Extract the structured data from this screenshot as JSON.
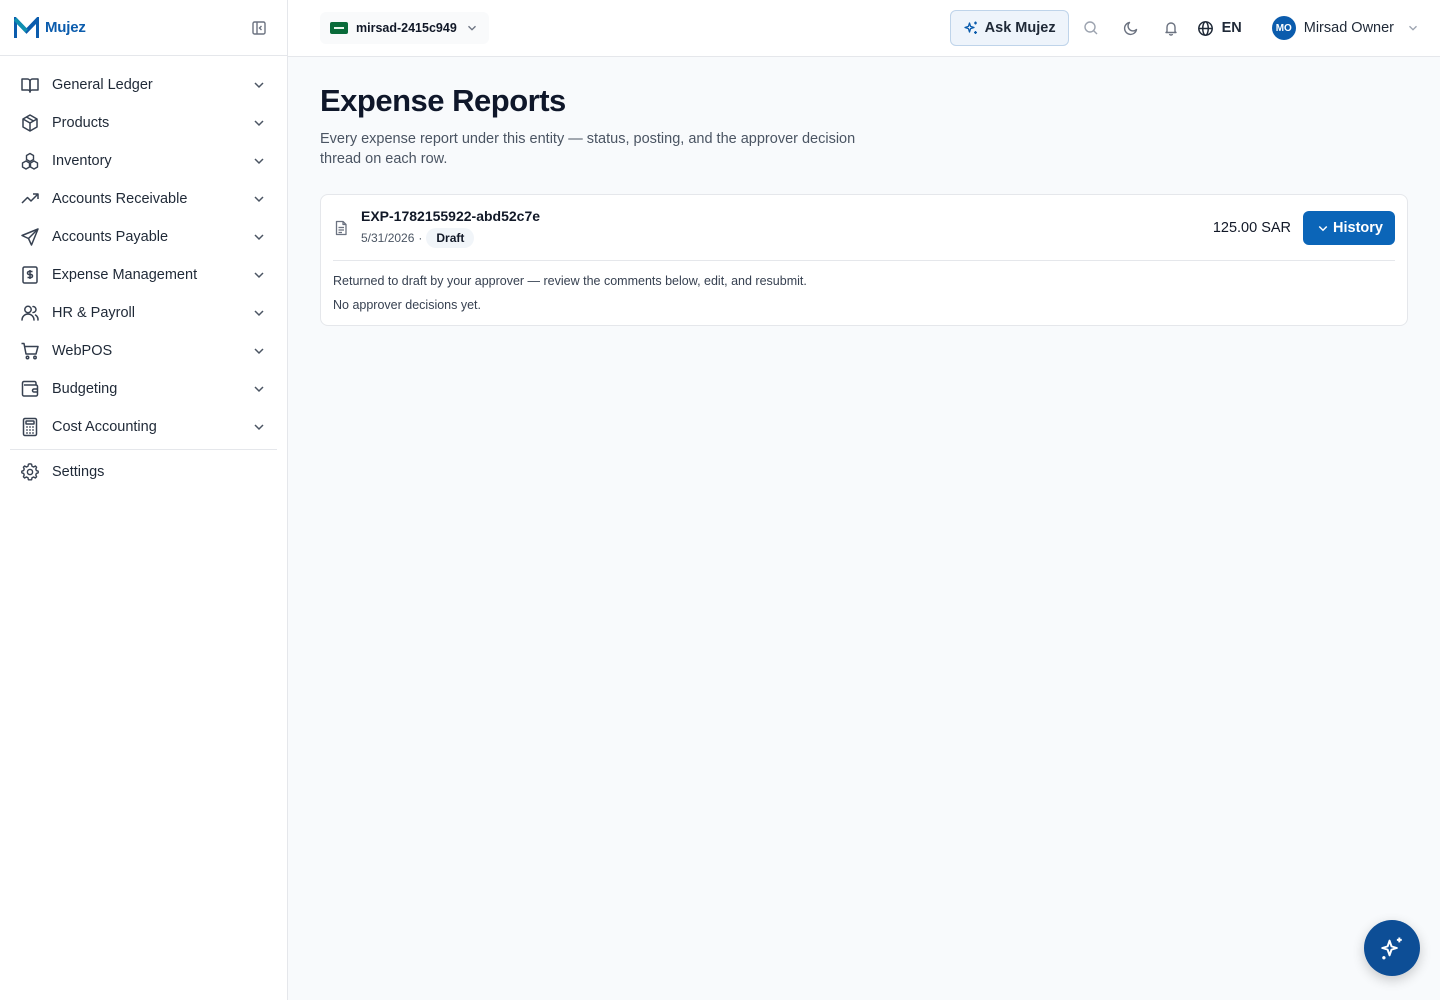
{
  "brand": {
    "name": "Mujez"
  },
  "sidebar": {
    "items": [
      {
        "label": "General Ledger",
        "icon": "book-open-icon"
      },
      {
        "label": "Products",
        "icon": "package-icon"
      },
      {
        "label": "Inventory",
        "icon": "boxes-icon"
      },
      {
        "label": "Accounts Receivable",
        "icon": "trending-up-icon"
      },
      {
        "label": "Accounts Payable",
        "icon": "send-icon"
      },
      {
        "label": "Expense Management",
        "icon": "receipt-dollar-icon"
      },
      {
        "label": "HR & Payroll",
        "icon": "users-icon"
      },
      {
        "label": "WebPOS",
        "icon": "shopping-cart-icon"
      },
      {
        "label": "Budgeting",
        "icon": "wallet-icon"
      },
      {
        "label": "Cost Accounting",
        "icon": "calculator-icon"
      }
    ],
    "settings": {
      "label": "Settings",
      "icon": "gear-icon"
    }
  },
  "topbar": {
    "entity": {
      "name": "mirsad-2415c949",
      "flag": "saudi-flag-icon"
    },
    "ask_label": "Ask Mujez",
    "language": "EN",
    "user": {
      "initials": "MO",
      "name": "Mirsad Owner"
    }
  },
  "page": {
    "title": "Expense Reports",
    "description": "Every expense report under this entity — status, posting, and the approver decision thread on each row."
  },
  "reports": [
    {
      "id": "EXP-1782155922-abd52c7e",
      "date": "5/31/2026",
      "date_sep": "·",
      "status": "Draft",
      "amount": "125.00 SAR",
      "history_label": "History",
      "note": "Returned to draft by your approver — review the comments below, edit, and resubmit.",
      "decisions": "No approver decisions yet."
    }
  ],
  "colors": {
    "brand": "#0b5cad",
    "primary_button": "#0b65b8",
    "fab": "#0d4e96"
  }
}
